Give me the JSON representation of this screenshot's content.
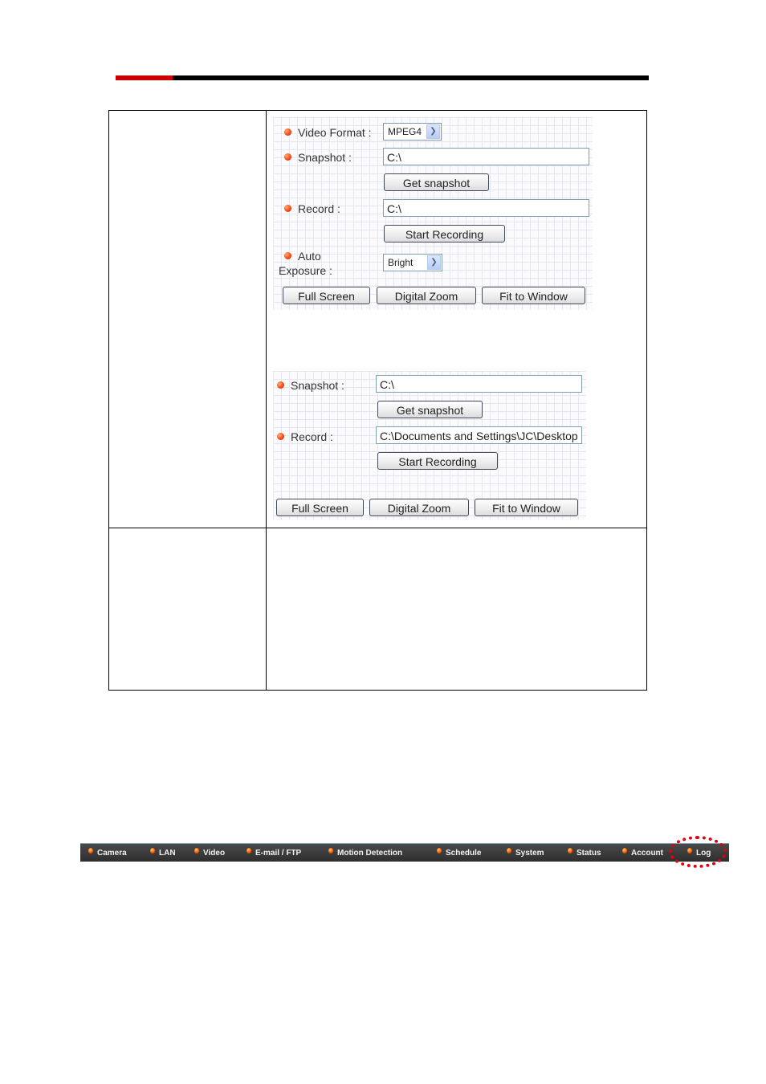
{
  "header": {
    "rule_colors": {
      "accent": "#cc0000",
      "main": "#000000"
    }
  },
  "table": {
    "row1": {
      "left_text": "",
      "panel1": {
        "video_format": {
          "label": "Video Format :",
          "value": "MPEG4",
          "icon": "chevron-down-icon"
        },
        "snapshot": {
          "label": "Snapshot :",
          "value": "C:\\"
        },
        "get_snapshot_label": "Get snapshot",
        "record": {
          "label": "Record :",
          "value": "C:\\"
        },
        "start_recording_label": "Start Recording",
        "auto_exposure": {
          "label_line1": "Auto",
          "label_line2": "Exposure :",
          "value": "Bright",
          "icon": "chevron-down-icon"
        },
        "buttons": [
          "Full Screen",
          "Digital Zoom",
          "Fit to Window"
        ]
      },
      "panel2": {
        "snapshot": {
          "label": "Snapshot :",
          "value": "C:\\"
        },
        "get_snapshot_label": "Get snapshot",
        "record": {
          "label": "Record :",
          "value": "C:\\Documents and Settings\\JC\\Desktop"
        },
        "start_recording_label": "Start Recording",
        "buttons": [
          "Full Screen",
          "Digital Zoom",
          "Fit to Window"
        ]
      }
    },
    "row2": {
      "left_text": "",
      "right_text": ""
    }
  },
  "navbar": {
    "items": [
      {
        "label": "Camera"
      },
      {
        "label": "LAN"
      },
      {
        "label": "Video"
      },
      {
        "label": "E-mail / FTP"
      },
      {
        "label": "Motion Detection"
      },
      {
        "label": "Schedule"
      },
      {
        "label": "System"
      },
      {
        "label": "Status"
      },
      {
        "label": "Account"
      },
      {
        "label": "Log"
      }
    ],
    "highlighted": "Log",
    "highlight_color": "#e00010"
  }
}
